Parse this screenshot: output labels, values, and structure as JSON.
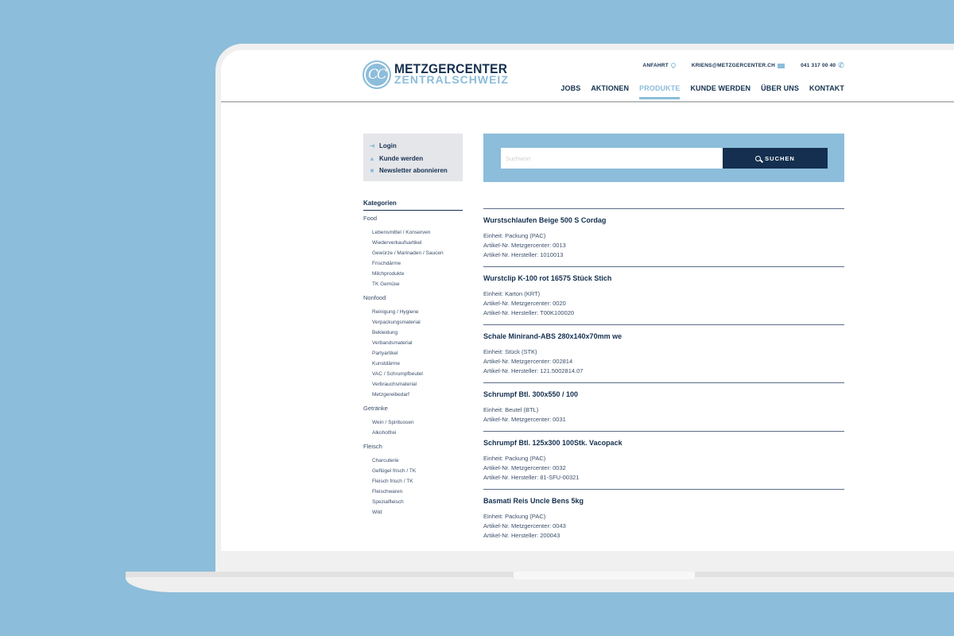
{
  "header": {
    "logo": {
      "mark": "CC",
      "line1": "METZGERCENTER",
      "line2": "ZENTRALSCHWEIZ"
    },
    "topbar": [
      {
        "label": "ANFAHRT",
        "icon": "map-pin-icon"
      },
      {
        "label": "KRIENS@METZGERCENTER.CH",
        "icon": "mail-icon"
      },
      {
        "label": "041 317 00 40",
        "icon": "phone-icon"
      }
    ],
    "nav": [
      {
        "label": "JOBS",
        "active": false
      },
      {
        "label": "AKTIONEN",
        "active": false
      },
      {
        "label": "PRODUKTE",
        "active": true
      },
      {
        "label": "KUNDE WERDEN",
        "active": false
      },
      {
        "label": "ÜBER UNS",
        "active": false
      },
      {
        "label": "KONTAKT",
        "active": false
      }
    ]
  },
  "account": [
    {
      "label": "Login",
      "icon": "login-icon"
    },
    {
      "label": "Kunde werden",
      "icon": "user-add-icon"
    },
    {
      "label": "Newsletter abonnieren",
      "icon": "document-icon"
    }
  ],
  "categories": {
    "title": "Kategorien",
    "groups": [
      {
        "label": "Food",
        "items": [
          "Lebensmittel / Konserven",
          "Wiederverkaufsartikel",
          "Gewürze / Marinaden / Saucen",
          "Frischdärme",
          "Milchprodukte",
          "TK Gemüse"
        ]
      },
      {
        "label": "Nonfood",
        "items": [
          "Reinigung / Hygiene",
          "Verpackungsmaterial",
          "Bekleidung",
          "Verbandsmaterial",
          "Partyartikel",
          "Kunstdärme",
          "VAC / Schrumpfbeutel",
          "Verbrauchsmaterial",
          "Metzgereibedarf"
        ]
      },
      {
        "label": "Getränke",
        "items": [
          "Wein / Spirituosen",
          "Alkoholfrei"
        ]
      },
      {
        "label": "Fleisch",
        "items": [
          "Charcuterie",
          "Geflügel frisch / TK",
          "Fleisch frisch / TK",
          "Fleischwaren",
          "Spezialfleisch",
          "Wild"
        ]
      }
    ]
  },
  "search": {
    "placeholder": "Suchwort",
    "value": "",
    "button_label": "SUCHEN"
  },
  "products": [
    {
      "title": "Wurstschlaufen Beige 500 S Cordag",
      "lines": [
        "Einheit: Packung (PAC)",
        "Artikel-Nr. Metzgercenter: 0013",
        "Artikel-Nr. Hersteller: 1010013"
      ]
    },
    {
      "title": "Wurstclip K-100 rot 16575 Stück Stich",
      "lines": [
        "Einheit: Karton (KRT)",
        "Artikel-Nr. Metzgercenter: 0020",
        "Artikel-Nr. Hersteller: T00K100020"
      ]
    },
    {
      "title": "Schale Minirand-ABS 280x140x70mm we",
      "lines": [
        "Einheit: Stück (STK)",
        "Artikel-Nr. Metzgercenter: 002814",
        "Artikel-Nr. Hersteller: 121.5002814.07"
      ]
    },
    {
      "title": "Schrumpf Btl. 300x550 / 100",
      "lines": [
        "Einheit: Beutel (BTL)",
        "Artikel-Nr. Metzgercenter: 0031"
      ]
    },
    {
      "title": "Schrumpf Btl. 125x300 100Stk. Vacopack",
      "lines": [
        "Einheit: Packung (PAC)",
        "Artikel-Nr. Metzgercenter: 0032",
        "Artikel-Nr. Hersteller: 81-SFU-00321"
      ]
    },
    {
      "title": "Basmati Reis Uncle Bens 5kg",
      "lines": [
        "Einheit: Packung (PAC)",
        "Artikel-Nr. Metzgercenter: 0043",
        "Artikel-Nr. Hersteller: 200043"
      ]
    }
  ],
  "colors": {
    "background": "#8cbdda",
    "accent": "#8cbdda",
    "navy": "#15304f",
    "button": "#142f4f"
  }
}
